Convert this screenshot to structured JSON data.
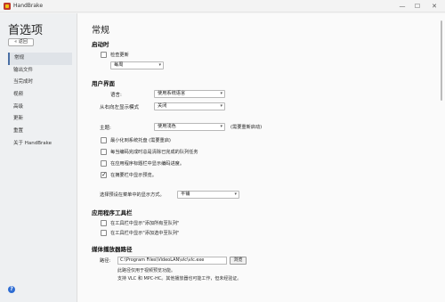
{
  "window": {
    "title": "HandBrake",
    "minimize": "—",
    "maximize": "☐",
    "close": "✕"
  },
  "sidebar": {
    "title": "首选项",
    "back_label": "« 返回",
    "items": [
      {
        "label": "常规"
      },
      {
        "label": "输出文件"
      },
      {
        "label": "当完成时"
      },
      {
        "label": "视频"
      },
      {
        "label": "高级"
      },
      {
        "label": "更新"
      },
      {
        "label": "重置"
      },
      {
        "label": "关于 HandBrake"
      }
    ],
    "help": "?"
  },
  "main": {
    "title": "常规",
    "startup": {
      "heading": "启动时",
      "check_updates_label": "检查更新",
      "check_updates_checked": false,
      "frequency_value": "每周"
    },
    "ui": {
      "heading": "用户界面",
      "language_label": "语言:",
      "language_value": "使用系统语言",
      "rtl_label": "从右向左显示模式",
      "rtl_value": "关闭",
      "theme_label": "主题:",
      "theme_value": "使用浅色",
      "theme_note": "(需要重新启动)",
      "options": [
        {
          "label": "最小化到系统托盘 (需要重启)",
          "checked": false
        },
        {
          "label": "每当编码完成时总是清除已完成的队列任务",
          "checked": false
        },
        {
          "label": "在应用程序标题栏中显示编码进度。",
          "checked": false
        },
        {
          "label": "在摘要栏中显示预览。",
          "checked": true
        }
      ],
      "preview_mode_label": "选择预设在菜单中的显示方式。",
      "preview_mode_value": "平铺"
    },
    "toolbar": {
      "heading": "应用程序工具栏",
      "options": [
        {
          "label": "在工具栏中显示\"添加所有至队列\"",
          "checked": false
        },
        {
          "label": "在工具栏中显示\"添加选中至队列\"",
          "checked": false
        }
      ]
    },
    "player": {
      "heading": "媒体播放器路径",
      "path_label": "路径:",
      "path_value": "C:\\Program Files\\VideoLAN\\vlc\\vlc.exe",
      "browse_label": "浏览",
      "note_line1": "此路径仅用于视频预览功能。",
      "note_line2": "支持 VLC 和 MPC-HC。其他播放器也可能工作，但未经验证。"
    }
  }
}
